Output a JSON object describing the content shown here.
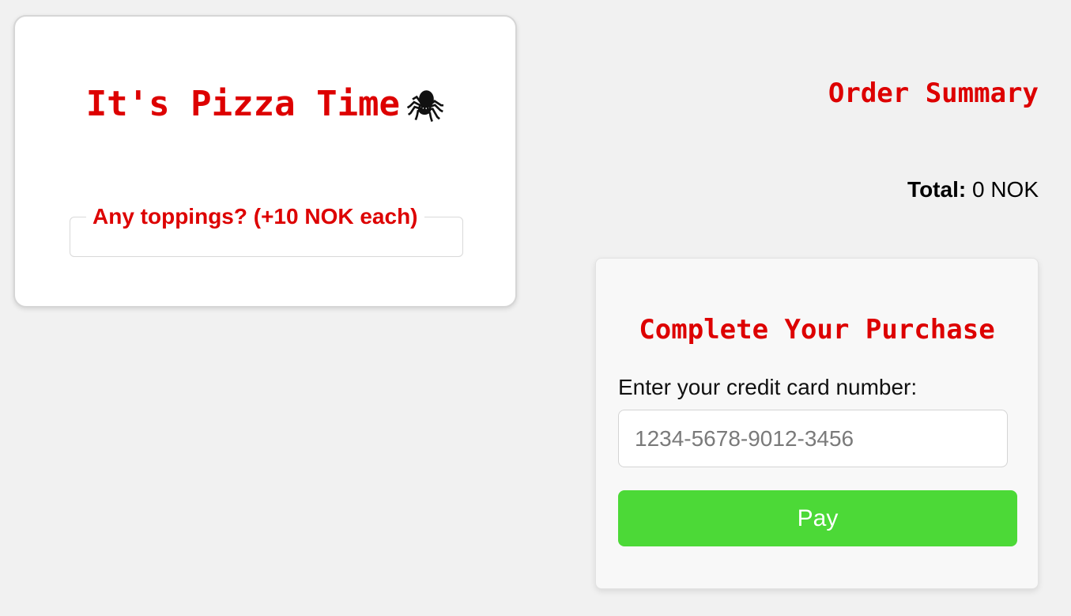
{
  "menu": {
    "title": "It's Pizza Time",
    "title_emoji": "🕷",
    "toppings_legend": "Any toppings? (+10 NOK each)"
  },
  "summary": {
    "title": "Order Summary",
    "total_label": "Total:",
    "total_value": "0 NOK"
  },
  "checkout": {
    "title": "Complete Your Purchase",
    "card_label": "Enter your credit card number:",
    "card_placeholder": "1234-5678-9012-3456",
    "card_value": "",
    "pay_label": "Pay"
  },
  "colors": {
    "accent_red": "#dd0000",
    "pay_green": "#4cd937",
    "page_background": "#f1f1f1"
  },
  "icons": {
    "title_icon": "spider-icon"
  }
}
